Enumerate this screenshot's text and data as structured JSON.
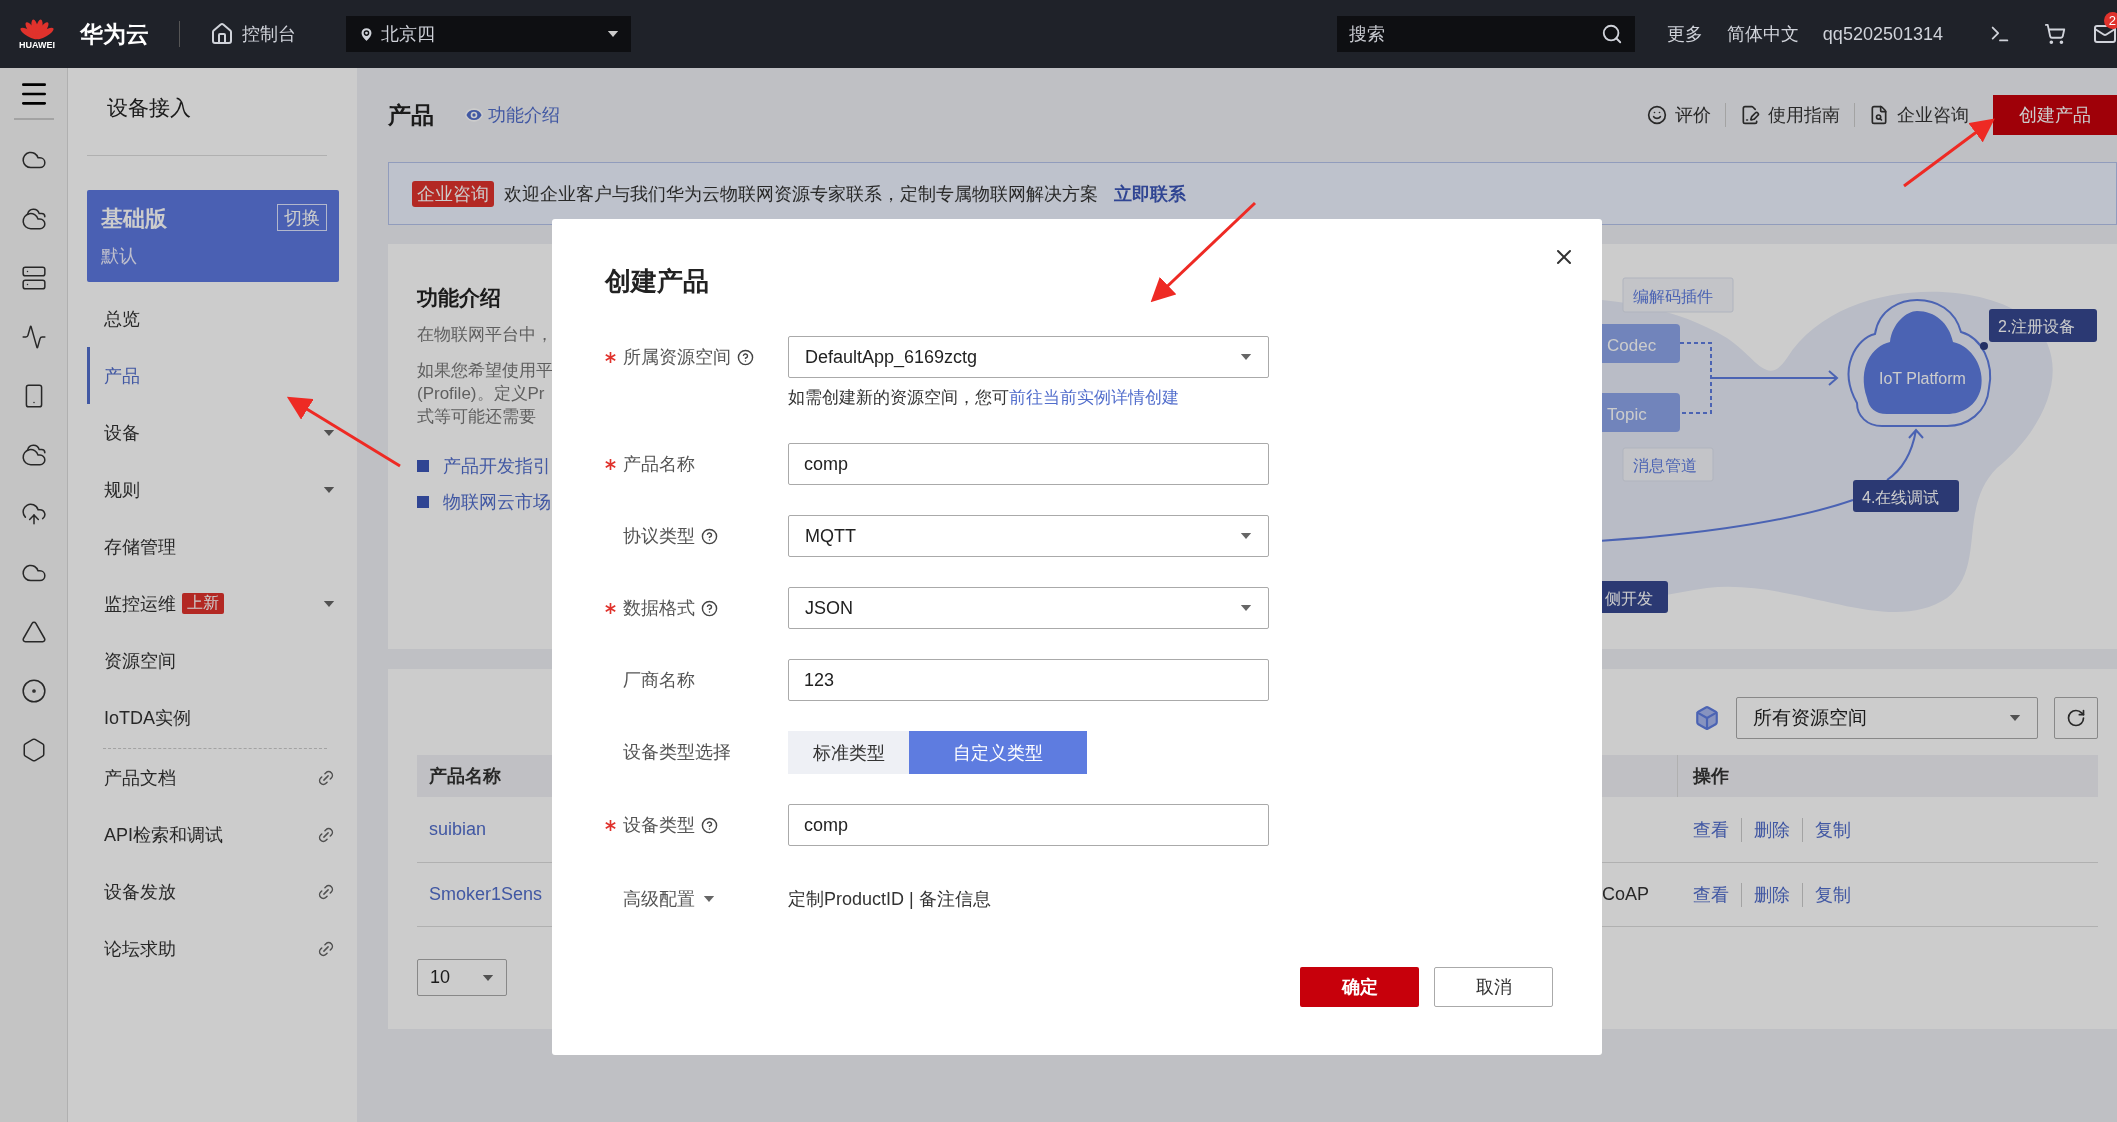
{
  "top_bar": {
    "logo_text": "HUAWEI",
    "brand": "华为云",
    "console": "控制台",
    "region": "北京四",
    "search": {
      "placeholder": "搜索"
    },
    "links": [
      "更多",
      "简体中文",
      "qq5202501314"
    ],
    "mail_badge": "2"
  },
  "sidebar": {
    "title": "设备接入",
    "edition": {
      "name": "基础版",
      "subtitle": "默认",
      "switch": "切换"
    },
    "items": [
      {
        "label": "总览",
        "kind": "plain",
        "selected": false
      },
      {
        "label": "产品",
        "kind": "plain",
        "selected": true
      },
      {
        "label": "设备",
        "kind": "expandable",
        "selected": false
      },
      {
        "label": "规则",
        "kind": "expandable",
        "selected": false
      },
      {
        "label": "存储管理",
        "kind": "plain",
        "selected": false
      },
      {
        "label": "监控运维",
        "kind": "expandable",
        "badge": "上新",
        "selected": false
      },
      {
        "label": "资源空间",
        "kind": "plain",
        "selected": false
      },
      {
        "label": "IoTDA实例",
        "kind": "plain",
        "selected": false
      },
      {
        "label": "产品文档",
        "kind": "link",
        "selected": false
      },
      {
        "label": "API检索和调试",
        "kind": "link",
        "selected": false
      },
      {
        "label": "设备发放",
        "kind": "link",
        "selected": false
      },
      {
        "label": "论坛求助",
        "kind": "link",
        "selected": false
      }
    ]
  },
  "header": {
    "title": "产品",
    "intro_link": "功能介绍",
    "actions": [
      {
        "label": "评价",
        "kind": "feedback"
      },
      {
        "label": "使用指南",
        "kind": "guide"
      },
      {
        "label": "企业咨询",
        "kind": "consult"
      }
    ],
    "create_button": "创建产品"
  },
  "banner": {
    "tag": "企业咨询",
    "text": "欢迎企业客户与我们华为云物联网资源专家联系，定制专属物联网解决方案",
    "link": "立即联系"
  },
  "intro": {
    "title": "功能介绍",
    "paragraphs": [
      "在物联网平台中，",
      "如果您希望使用平",
      "(Profile)。定义Pr",
      "式等可能还需要"
    ],
    "links": [
      "产品开发指引",
      "物联网云市场"
    ],
    "diagram": {
      "plugin_tag": "编解码插件",
      "codec": "Codec",
      "topic": "Topic",
      "channel_tag": "消息管道",
      "platform": "IoT Platform",
      "step_register": "2.注册设备",
      "step_debug": "4.在线调试",
      "step_dev": "侧开发"
    }
  },
  "products": {
    "space_filter": "所有资源空间",
    "columns": {
      "name": "产品名称",
      "actions": "操作"
    },
    "rows": [
      {
        "name": "suibian",
        "actions": [
          "查看",
          "删除",
          "复制"
        ]
      },
      {
        "name": "Smoker1Sens",
        "protocol": "CoAP",
        "actions": [
          "查看",
          "删除",
          "复制"
        ]
      }
    ],
    "page_size": "10"
  },
  "dialog": {
    "title": "创建产品",
    "fields": [
      {
        "label": "所属资源空间",
        "required": true,
        "help": true,
        "kind": "select",
        "value": "DefaultApp_6169zctg",
        "hint": "如需创建新的资源空间，您可",
        "hint_link": "前往当前实例详情创建"
      },
      {
        "label": "产品名称",
        "required": true,
        "help": false,
        "kind": "input",
        "value": "comp"
      },
      {
        "label": "协议类型",
        "required": false,
        "help": true,
        "kind": "select",
        "value": "MQTT"
      },
      {
        "label": "数据格式",
        "required": true,
        "help": true,
        "kind": "select",
        "value": "JSON"
      },
      {
        "label": "厂商名称",
        "required": false,
        "help": false,
        "kind": "input",
        "value": "123"
      },
      {
        "label": "设备类型选择",
        "required": false,
        "help": false,
        "kind": "segmented",
        "options": [
          {
            "label": "标准类型",
            "selected": false
          },
          {
            "label": "自定义类型",
            "selected": true
          }
        ]
      },
      {
        "label": "设备类型",
        "required": true,
        "help": true,
        "kind": "input",
        "value": "comp"
      },
      {
        "label": "高级配置",
        "required": false,
        "help": false,
        "kind": "advanced",
        "value": "定制ProductID | 备注信息"
      }
    ],
    "buttons": [
      {
        "label": "确定",
        "kind": "primary"
      },
      {
        "label": "取消",
        "kind": "secondary"
      }
    ]
  }
}
